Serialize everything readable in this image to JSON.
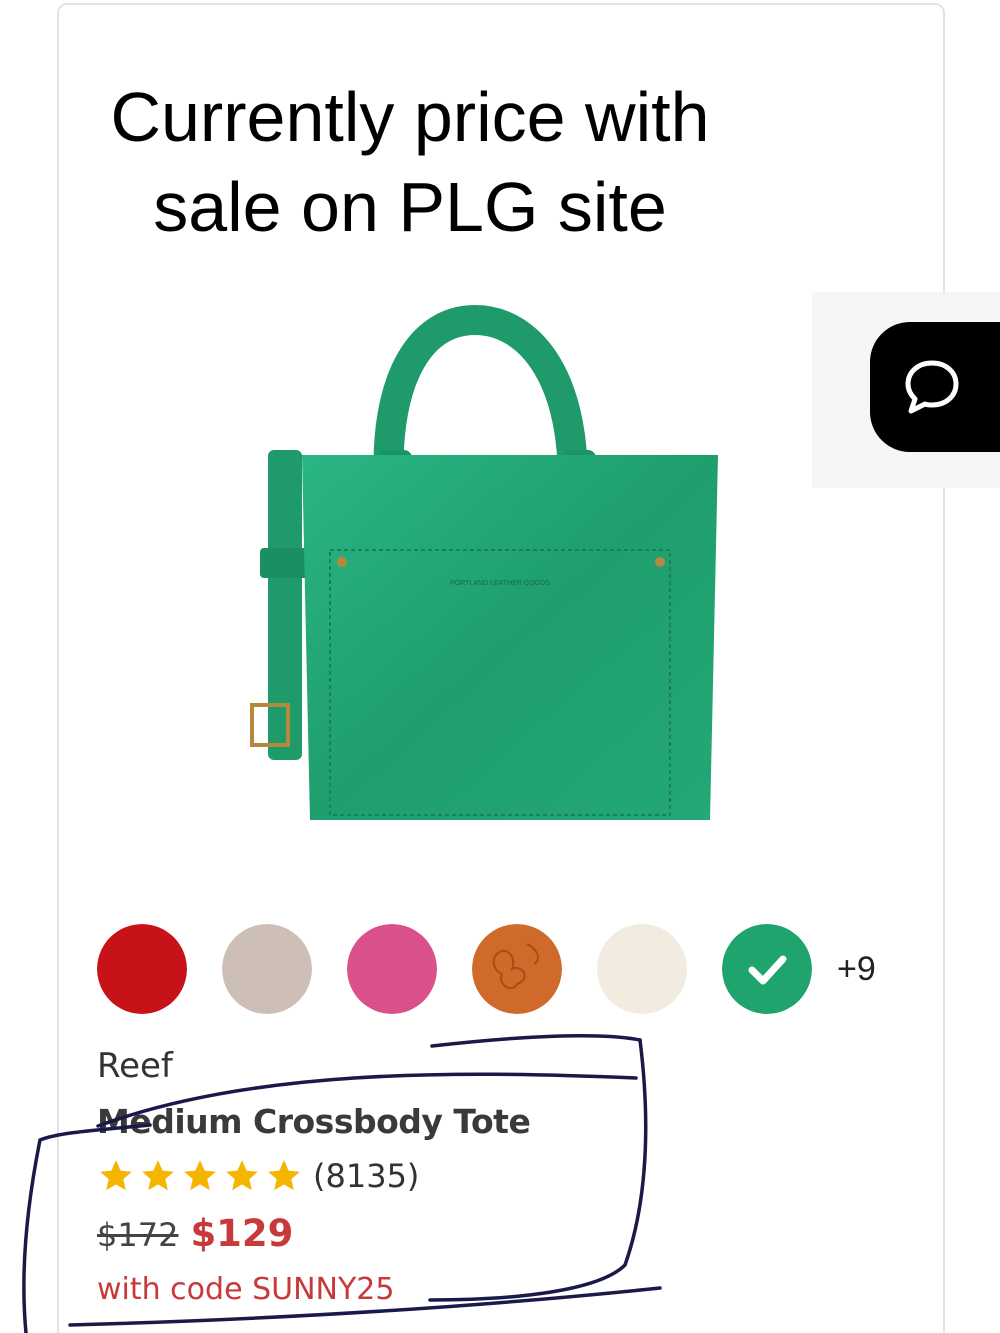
{
  "annotation": {
    "text": "Currently price with\nsale on PLG site"
  },
  "chat": {
    "icon": "chat-bubble-icon"
  },
  "product": {
    "image_icon": "green-leather-tote-bag",
    "brand_stamp": "PORTLAND LEATHER GOODS",
    "color_name": "Reef",
    "title": "Medium Crossbody Tote",
    "rating_stars": 5,
    "review_count": "(8135)",
    "original_price": "$172",
    "sale_price": "$129",
    "promo": "with code SUNNY25"
  },
  "swatches": {
    "more_label": "+9",
    "items": [
      {
        "color": "#c8121a",
        "selected": false
      },
      {
        "color": "#cdbfb8",
        "selected": false
      },
      {
        "color": "#d9508a",
        "selected": false
      },
      {
        "color": "#d06a2a",
        "selected": false
      },
      {
        "color": "#f1ebe0",
        "selected": false
      },
      {
        "color": "#1fa46e",
        "selected": true
      }
    ]
  },
  "colors": {
    "sale_red": "#c8393b",
    "star_yellow": "#f4b400",
    "bag_green": "#23a876",
    "ink": "#1a1a4a"
  }
}
